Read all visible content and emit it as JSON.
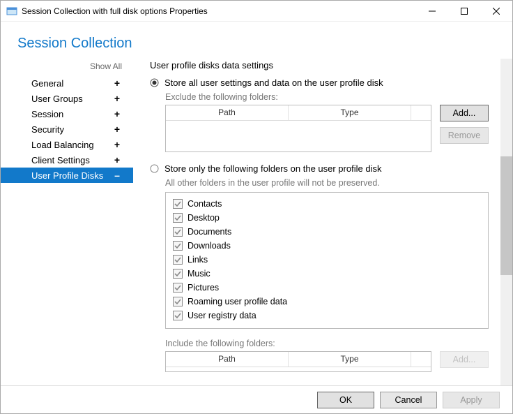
{
  "window": {
    "title": "Session Collection with full disk options Properties"
  },
  "header": "Session Collection",
  "sidebar": {
    "show_all": "Show All",
    "items": [
      {
        "label": "General",
        "glyph": "+",
        "active": false
      },
      {
        "label": "User Groups",
        "glyph": "+",
        "active": false
      },
      {
        "label": "Session",
        "glyph": "+",
        "active": false
      },
      {
        "label": "Security",
        "glyph": "+",
        "active": false
      },
      {
        "label": "Load Balancing",
        "glyph": "+",
        "active": false
      },
      {
        "label": "Client Settings",
        "glyph": "+",
        "active": false
      },
      {
        "label": "User Profile Disks",
        "glyph": "–",
        "active": true
      }
    ]
  },
  "main": {
    "section_title": "User profile disks data settings",
    "radio1": "Store all user settings and data on the user profile disk",
    "exclude_label": "Exclude the following folders:",
    "col_path": "Path",
    "col_type": "Type",
    "btn_add": "Add...",
    "btn_remove": "Remove",
    "radio2": "Store only the following folders on the user profile disk",
    "radio2_sub": "All other folders in the user profile will not be preserved.",
    "folders": [
      "Contacts",
      "Desktop",
      "Documents",
      "Downloads",
      "Links",
      "Music",
      "Pictures",
      "Roaming user profile data",
      "User registry data"
    ],
    "include_label": "Include the following folders:",
    "btn_add2": "Add..."
  },
  "footer": {
    "ok": "OK",
    "cancel": "Cancel",
    "apply": "Apply"
  }
}
